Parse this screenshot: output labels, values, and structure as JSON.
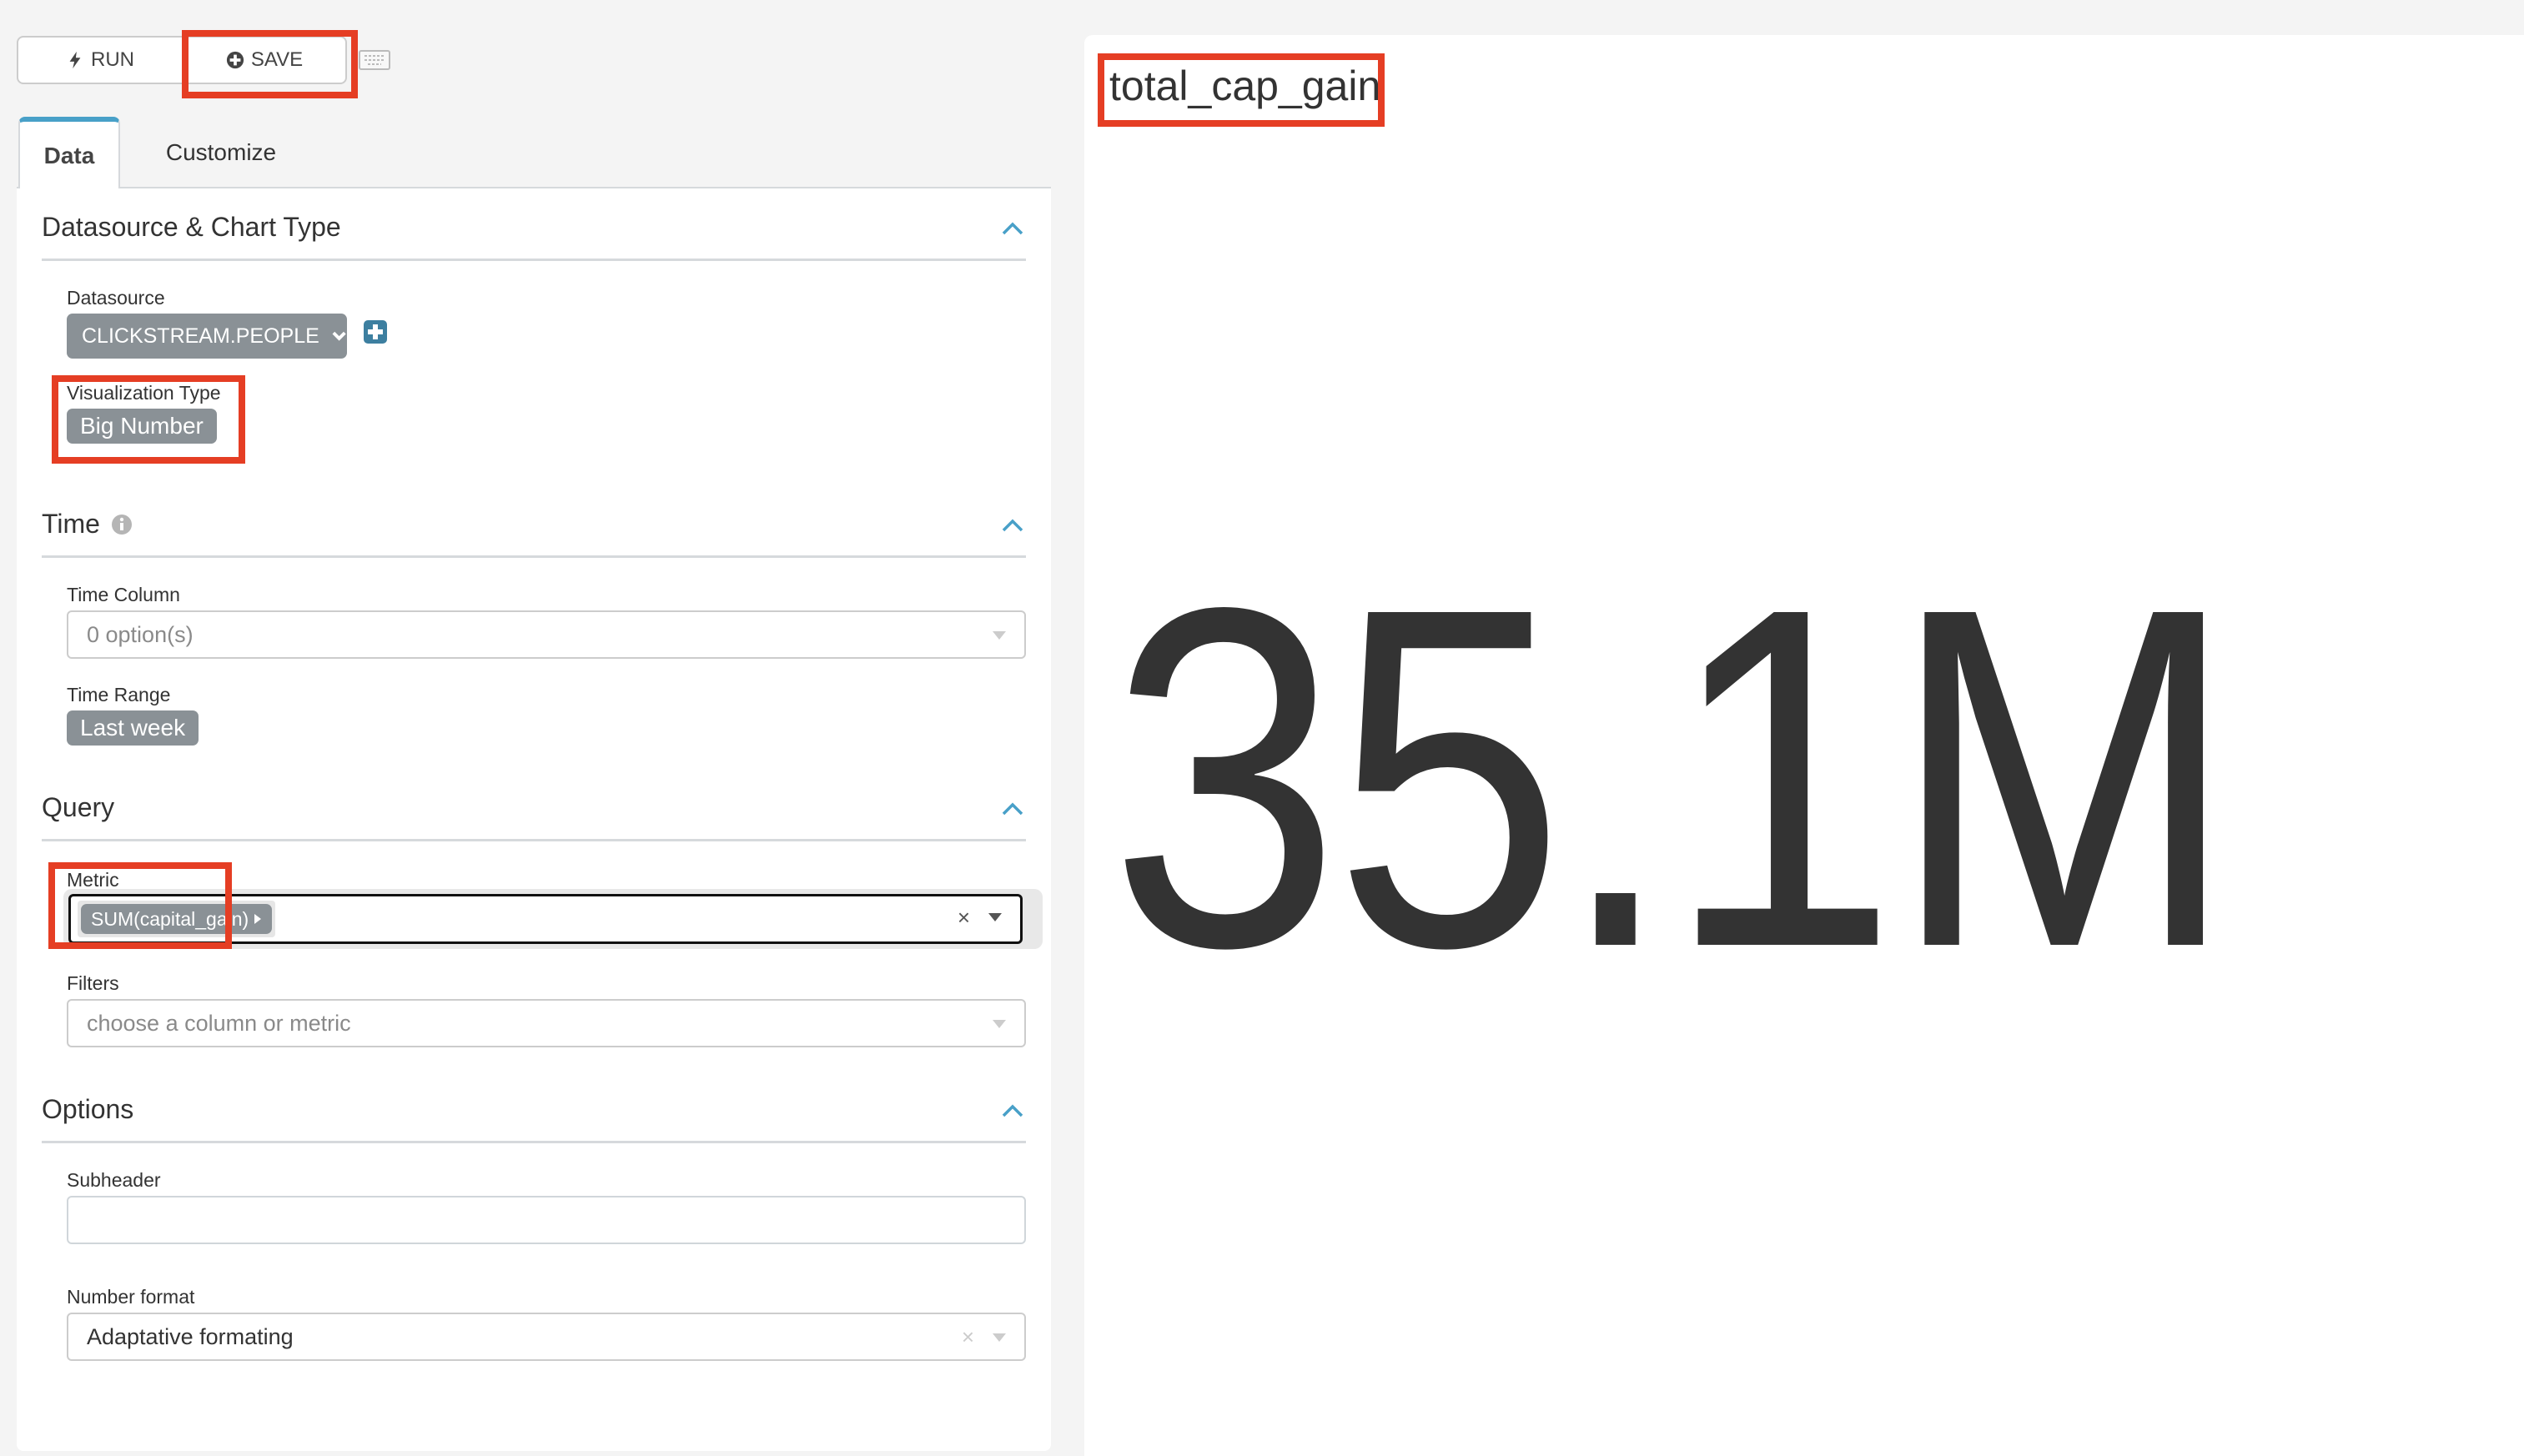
{
  "toolbar": {
    "run_label": "RUN",
    "save_label": "SAVE",
    "run_icon": "bolt-icon",
    "save_icon": "plus-circle-icon",
    "keyboard_icon": "keyboard-icon"
  },
  "tabs": [
    {
      "label": "Data",
      "active": true
    },
    {
      "label": "Customize",
      "active": false
    }
  ],
  "sections": {
    "datasource": {
      "title": "Datasource & Chart Type",
      "datasource_label": "Datasource",
      "datasource_value": "CLICKSTREAM.PEOPLE",
      "viz_type_label": "Visualization Type",
      "viz_type_value": "Big Number"
    },
    "time": {
      "title": "Time",
      "time_column_label": "Time Column",
      "time_column_placeholder": "0 option(s)",
      "time_range_label": "Time Range",
      "time_range_value": "Last week"
    },
    "query": {
      "title": "Query",
      "metric_label": "Metric",
      "metric_value": "SUM(capital_gain)",
      "filters_label": "Filters",
      "filters_placeholder": "choose a column or metric"
    },
    "options": {
      "title": "Options",
      "subheader_label": "Subheader",
      "subheader_value": "",
      "number_format_label": "Number format",
      "number_format_value": "Adaptative formating"
    }
  },
  "chart": {
    "title": "total_cap_gain",
    "big_number": "35.1M"
  },
  "colors": {
    "accent": "#48a0c8",
    "highlight": "#e53e24",
    "pill": "#8a9196",
    "add_button": "#3d7fa0"
  }
}
